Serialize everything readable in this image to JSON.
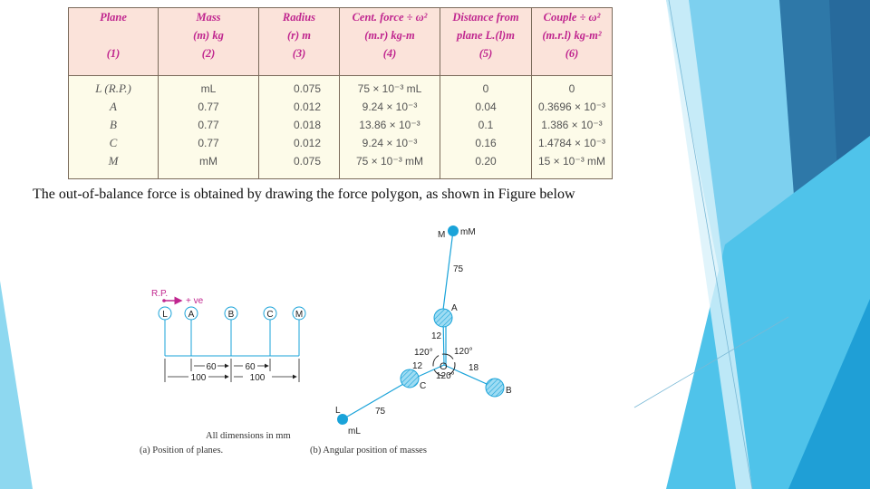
{
  "table": {
    "headers": [
      {
        "line1": "Plane",
        "line2": "",
        "line3": "(1)"
      },
      {
        "line1": "Mass",
        "line2": "(m) kg",
        "line3": "(2)"
      },
      {
        "line1": "Radius",
        "line2": "(r) m",
        "line3": "(3)"
      },
      {
        "line1": "Cent. force ÷ ω²",
        "line2": "(m.r) kg-m",
        "line3": "(4)"
      },
      {
        "line1": "Distance from",
        "line2": "plane L.(l)m",
        "line3": "(5)"
      },
      {
        "line1": "Couple ÷ ω²",
        "line2": "(m.r.l) kg-m²",
        "line3": "(6)"
      }
    ],
    "rows": [
      {
        "plane": "L (R.P.)",
        "mass": "mL",
        "radius": "0.075",
        "force": "75 × 10⁻³ mL",
        "distance": "0",
        "couple": "0"
      },
      {
        "plane": "A",
        "mass": "0.77",
        "radius": "0.012",
        "force": "9.24 × 10⁻³",
        "distance": "0.04",
        "couple": "0.3696 × 10⁻³"
      },
      {
        "plane": "B",
        "mass": "0.77",
        "radius": "0.018",
        "force": "13.86 × 10⁻³",
        "distance": "0.1",
        "couple": "1.386 × 10⁻³"
      },
      {
        "plane": "C",
        "mass": "0.77",
        "radius": "0.012",
        "force": "9.24 × 10⁻³",
        "distance": "0.16",
        "couple": "1.4784 × 10⁻³"
      },
      {
        "plane": "M",
        "mass": "mM",
        "radius": "0.075",
        "force": "75 × 10⁻³ mM",
        "distance": "0.20",
        "couple": "15 × 10⁻³ mM"
      }
    ]
  },
  "caption": "The out-of-balance force is obtained by drawing the force polygon, as shown in Figure below",
  "figure_a": {
    "rp_label": "R.P.",
    "direction_label": "+ ve",
    "planes": [
      "L",
      "A",
      "B",
      "C",
      "M"
    ],
    "dims": {
      "d1": "60",
      "d2": "60",
      "d3": "100",
      "d4": "100"
    },
    "note": "All dimensions in mm",
    "caption": "(a) Position of planes."
  },
  "figure_b": {
    "labels": {
      "M": "M",
      "mM": "mM",
      "A": "A",
      "B": "B",
      "C": "C",
      "L": "L",
      "mL": "mL",
      "O": "O"
    },
    "radii": {
      "M": "75",
      "A": "12",
      "C": "12",
      "B": "18",
      "L": "75"
    },
    "angles": {
      "a1": "120°",
      "a2": "120°",
      "a3": "120°"
    },
    "caption": "(b) Angular position of masses"
  },
  "colors": {
    "accent": "#1aa3d9",
    "header_text": "#c0268f",
    "header_bg": "#fbe3da",
    "body_bg": "#fdfbe9"
  }
}
